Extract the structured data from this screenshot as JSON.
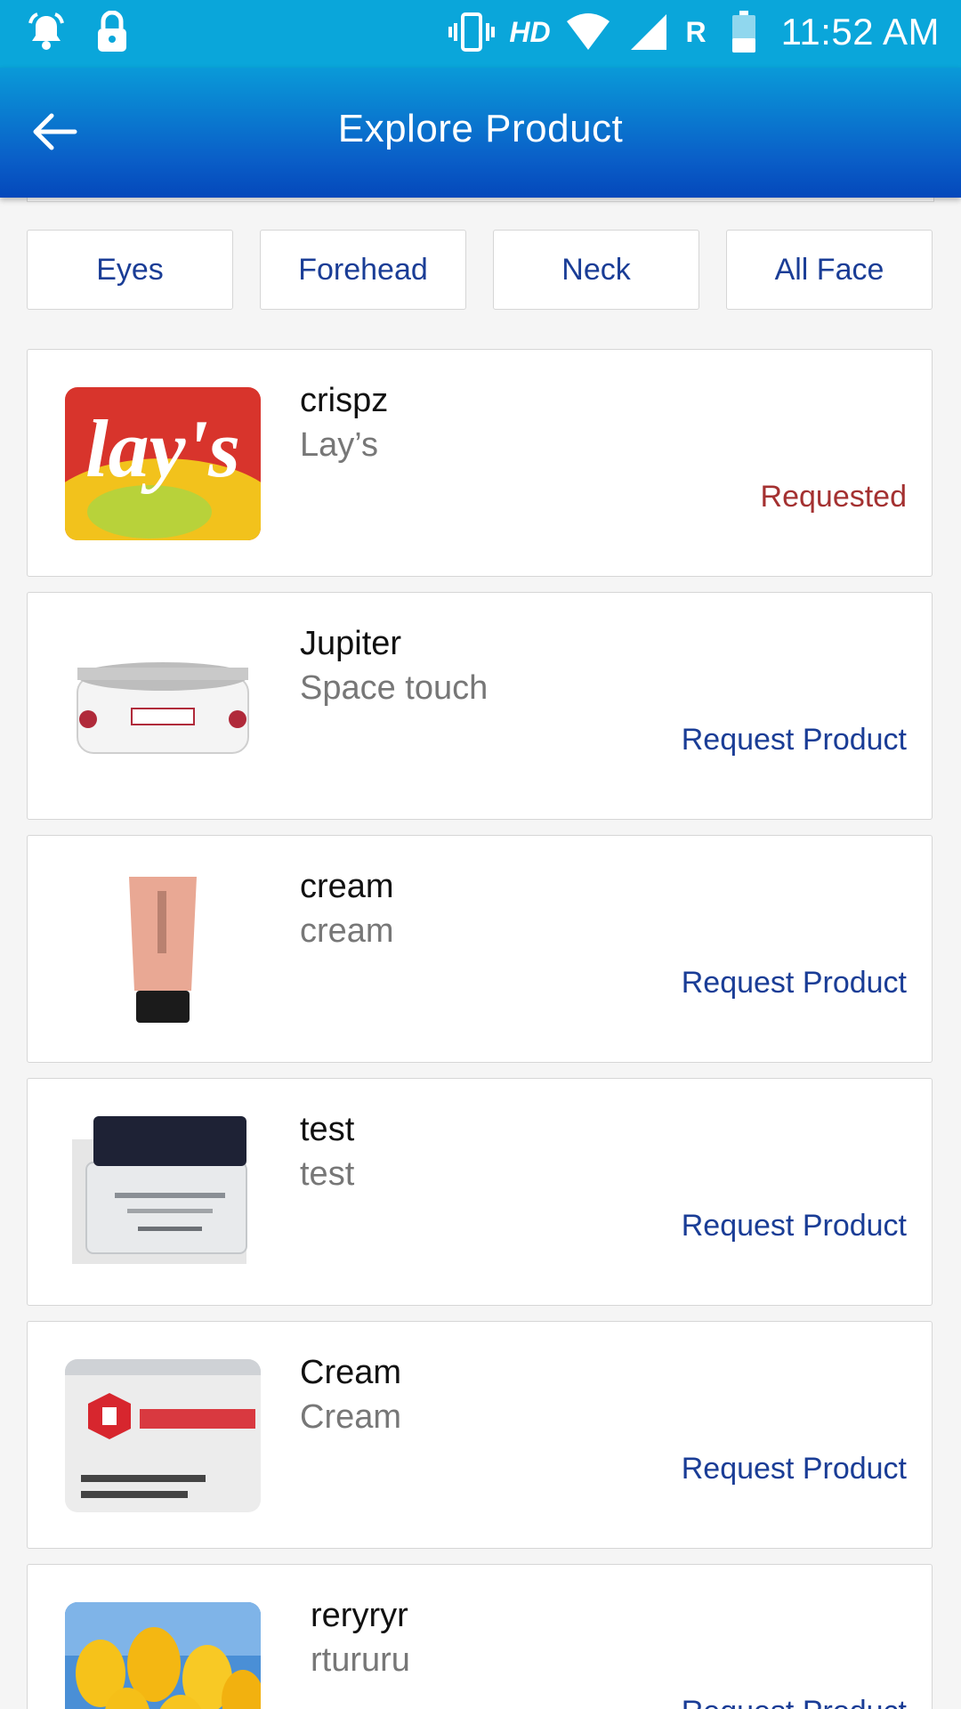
{
  "status_bar": {
    "time": "11:52 AM",
    "network_label": "HD",
    "roaming_label": "R",
    "icons": [
      "alarm-icon",
      "lock-icon",
      "vibrate-icon",
      "wifi-icon",
      "signal-icon",
      "battery-icon"
    ]
  },
  "app_bar": {
    "title": "Explore Product",
    "back_icon": "arrow-left-icon"
  },
  "filters": [
    {
      "label": "Eyes"
    },
    {
      "label": "Forehead"
    },
    {
      "label": "Neck"
    },
    {
      "label": "All Face"
    }
  ],
  "products": [
    {
      "name": "crispz",
      "brand": "Lay’s",
      "action": "Requested",
      "image": "lays-chips-thumbnail"
    },
    {
      "name": "Jupiter",
      "brand": "Space touch",
      "action": "Request Product",
      "image": "cream-jar-thumbnail"
    },
    {
      "name": "cream",
      "brand": "cream",
      "action": "Request Product",
      "image": "cream-tube-thumbnail"
    },
    {
      "name": "test",
      "brand": "test",
      "action": "Request Product",
      "image": "eye-cream-jar-thumbnail"
    },
    {
      "name": "Cream",
      "brand": "Cream",
      "action": "Request Product",
      "image": "router-box-thumbnail"
    },
    {
      "name": "reryryr",
      "brand": "rtururu",
      "action": "Request Product",
      "image": "tulips-thumbnail"
    }
  ],
  "colors": {
    "status_bar": "#0aa6da",
    "app_bar_gradient_start": "#0a9ad8",
    "app_bar_gradient_end": "#0448bb",
    "accent_text": "#1a3d96",
    "requested_text": "#a43131"
  }
}
